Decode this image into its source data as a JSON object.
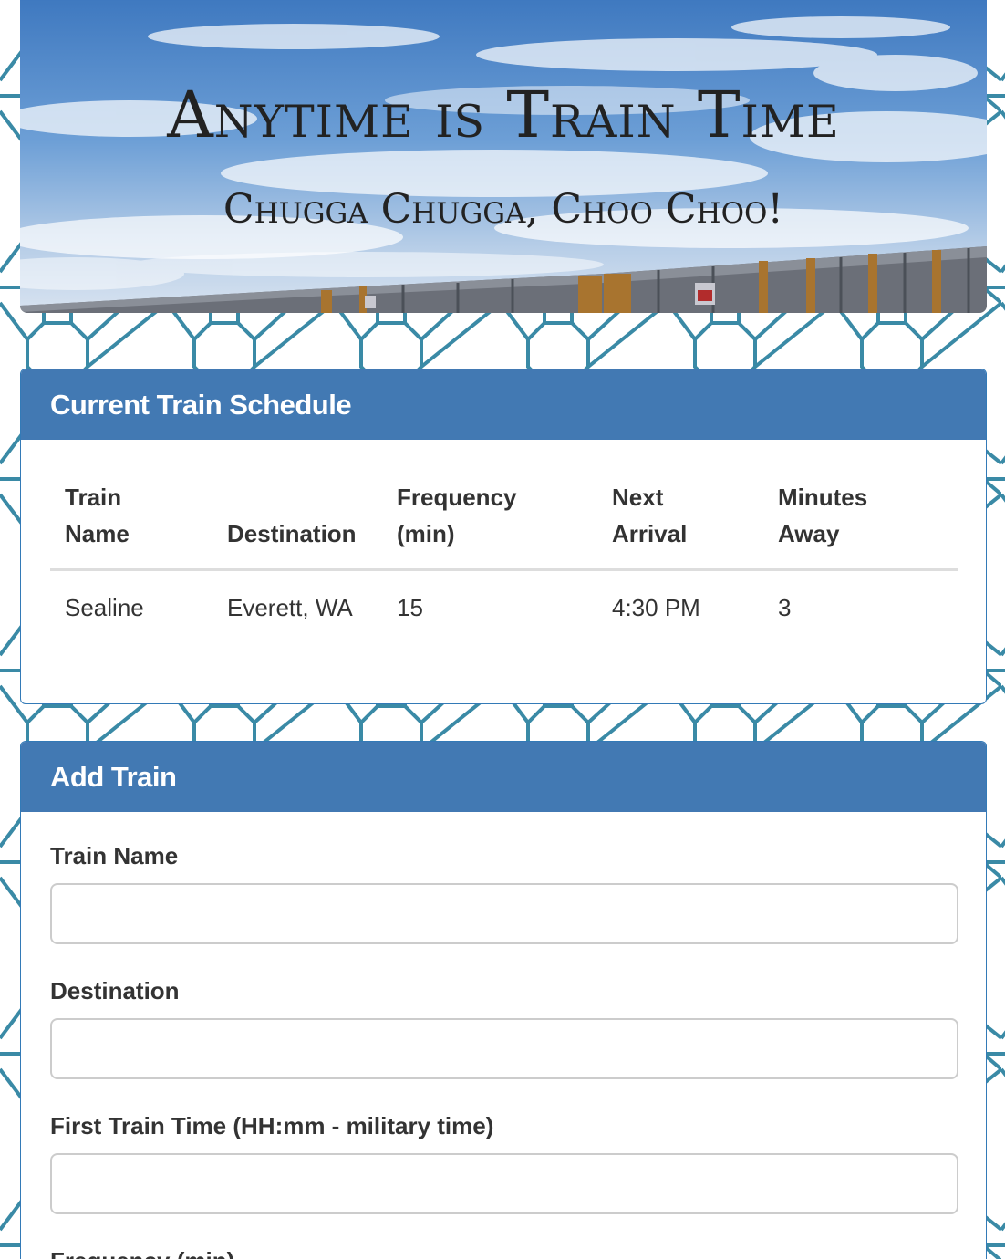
{
  "header": {
    "title": "Anytime is Train Time",
    "subtitle": "Chugga Chugga, Choo Choo!"
  },
  "schedule": {
    "panel_title": "Current Train Schedule",
    "columns": [
      {
        "line1": "Train",
        "line2": "Name"
      },
      {
        "line1": "",
        "line2": "Destination"
      },
      {
        "line1": "Frequency",
        "line2": "(min)"
      },
      {
        "line1": "Next",
        "line2": "Arrival"
      },
      {
        "line1": "Minutes",
        "line2": "Away"
      }
    ],
    "rows": [
      [
        "Sealine",
        "Everett, WA",
        "15",
        "4:30 PM",
        "3"
      ]
    ]
  },
  "add_train": {
    "panel_title": "Add Train",
    "fields": [
      {
        "label": "Train Name",
        "value": "",
        "placeholder": ""
      },
      {
        "label": "Destination",
        "value": "",
        "placeholder": ""
      },
      {
        "label": "First Train Time (HH:mm - military time)",
        "value": "",
        "placeholder": ""
      },
      {
        "label": "Frequency (min)",
        "value": "",
        "placeholder": ""
      }
    ]
  },
  "colors": {
    "panel_heading": "#4279b3",
    "panel_border": "#337ab7",
    "pattern_stroke": "#3a8aa6",
    "page_background": "#ffffff"
  }
}
